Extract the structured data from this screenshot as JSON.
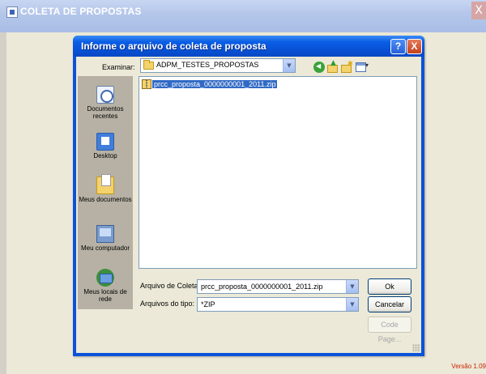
{
  "app": {
    "title": "COLETA DE PROPOSTAS",
    "close_glyph": "X",
    "version": "Versão 1.09"
  },
  "dialog": {
    "title": "Informe o arquivo de coleta de proposta",
    "help_glyph": "?",
    "close_glyph": "X",
    "look_in": {
      "label": "Examinar:",
      "value": "ADPM_TESTES_PROPOSTAS"
    },
    "toolbar_icons": [
      "back-icon",
      "up-folder-icon",
      "new-folder-icon",
      "views-menu-icon"
    ],
    "places": [
      {
        "label": "Documentos recentes",
        "icon": "recent-documents-icon"
      },
      {
        "label": "Desktop",
        "icon": "desktop-icon"
      },
      {
        "label": "Meus documentos",
        "icon": "my-documents-icon"
      },
      {
        "label": "Meu computador",
        "icon": "my-computer-icon"
      },
      {
        "label": "Meus locais de rede",
        "icon": "network-places-icon"
      }
    ],
    "files": [
      {
        "name": "prcc_proposta_0000000001_2011.zip",
        "icon": "zip-file-icon",
        "selected": true
      }
    ],
    "filename": {
      "label": "Arquivo de Coleta",
      "value": "prcc_proposta_0000000001_2011.zip"
    },
    "filetype": {
      "label": "Arquivos do tipo:",
      "value": "*ZIP"
    },
    "buttons": {
      "ok": "Ok",
      "cancel": "Cancelar",
      "code_page": "Code Page..."
    }
  }
}
